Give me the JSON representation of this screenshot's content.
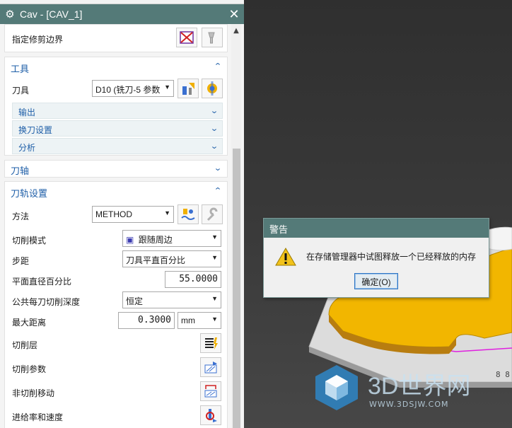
{
  "window": {
    "title": "Cav - [CAV_1]"
  },
  "boundary": {
    "label": "指定修剪边界"
  },
  "tool_section": {
    "title": "工具",
    "tool_label": "刀具",
    "tool_value": "D10 (铣刀-5 参数",
    "subsections": [
      "输出",
      "换刀设置",
      "分析"
    ]
  },
  "axis_section": {
    "title": "刀轴"
  },
  "path_section": {
    "title": "刀轨设置",
    "method_label": "方法",
    "method_value": "METHOD",
    "cut_pattern_label": "切削模式",
    "cut_pattern_value": "跟随周边",
    "stepover_label": "步距",
    "stepover_value": "刀具平直百分比",
    "percent_label": "平面直径百分比",
    "percent_value": "55.0000",
    "depth_label": "公共每刀切削深度",
    "depth_value": "恒定",
    "max_dist_label": "最大距离",
    "max_dist_value": "0.3000",
    "max_dist_unit": "mm",
    "levels_label": "切削层",
    "params_label": "切削参数",
    "noncut_label": "非切削移动",
    "feeds_label": "进给率和速度"
  },
  "warning": {
    "title": "警告",
    "message": "在存储管理器中试图释放一个已经释放的内存",
    "ok_label": "确定(O)"
  },
  "watermark": {
    "text": "3D世界网",
    "url": "WWW.3DSJW.COM"
  },
  "icons": {
    "gear": "gear-icon",
    "close": "close-icon",
    "chevron_up": "chevron-up-icon",
    "chevron_down": "chevron-down-icon",
    "warning": "warning-icon"
  },
  "colors": {
    "titlebar": "#547a78",
    "section_blue": "#1f5fa8",
    "part_yellow": "#f3b500"
  }
}
